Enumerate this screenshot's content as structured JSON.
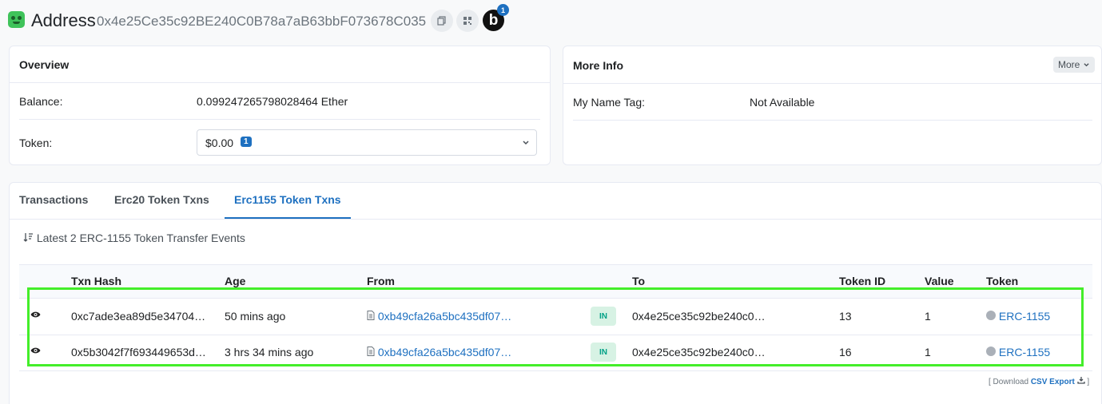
{
  "header": {
    "title": "Address",
    "address": "0x4e25Ce35c92BE240C0B78a7aB63bbF073678C035",
    "copy_icon": "copy-icon",
    "qr_icon": "qr-code-icon",
    "blockscan_letter": "b",
    "blockscan_count": "1"
  },
  "overview": {
    "title": "Overview",
    "balance_label": "Balance:",
    "balance_value": "0.099247265798028464 Ether",
    "token_label": "Token:",
    "token_value": "$0.00",
    "token_count": "1"
  },
  "more_info": {
    "title": "More Info",
    "more_button": "More",
    "name_tag_label": "My Name Tag:",
    "name_tag_value": "Not Available"
  },
  "tabs": [
    {
      "label": "Transactions"
    },
    {
      "label": "Erc20 Token Txns"
    },
    {
      "label": "Erc1155 Token Txns",
      "active": true
    }
  ],
  "summary": "Latest 2 ERC-1155 Token Transfer Events",
  "table": {
    "columns": [
      "Txn Hash",
      "Age",
      "From",
      "To",
      "Token ID",
      "Value",
      "Token"
    ],
    "rows": [
      {
        "hash": "0xc7ade3ea89d5e34704…",
        "age": "50 mins ago",
        "from": "0xb49cfa26a5bc435df07…",
        "direction": "IN",
        "to": "0x4e25ce35c92be240c0…",
        "token_id": "13",
        "value": "1",
        "token": "ERC-1155"
      },
      {
        "hash": "0x5b3042f7f693449653d…",
        "age": "3 hrs 34 mins ago",
        "from": "0xb49cfa26a5bc435df07…",
        "direction": "IN",
        "to": "0x4e25ce35c92be240c0…",
        "token_id": "16",
        "value": "1",
        "token": "ERC-1155"
      }
    ]
  },
  "footer": {
    "prefix": "[ Download",
    "link": "CSV Export",
    "suffix": "]"
  },
  "colors": {
    "accent": "#1e70c0",
    "highlight": "#44ee2a",
    "in_badge": "#d7f2e4"
  }
}
